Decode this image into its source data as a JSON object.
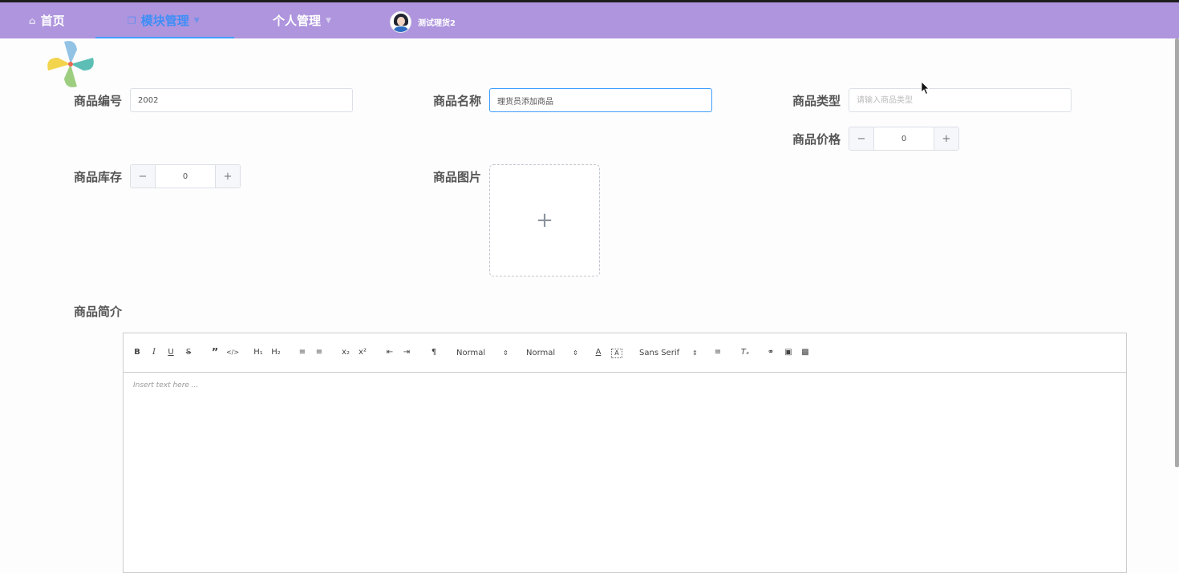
{
  "nav": {
    "home": "首页",
    "modules": "模块管理",
    "personal": "个人管理",
    "user_name": "测试理货2"
  },
  "form": {
    "code_label": "商品编号",
    "code_value": "2002",
    "name_label": "商品名称",
    "name_value": "理货员添加商品",
    "type_label": "商品类型",
    "type_placeholder": "请输入商品类型",
    "price_label": "商品价格",
    "price_value": "0",
    "stock_label": "商品库存",
    "stock_value": "0",
    "image_label": "商品图片",
    "desc_label": "商品简介"
  },
  "editor": {
    "tb_header1": "H₁",
    "tb_header2": "H₂",
    "tb_sub": "x₂",
    "tb_sup": "x²",
    "size_label": "Normal",
    "header_label": "Normal",
    "font_label": "Sans Serif",
    "placeholder": "Insert text here ..."
  },
  "colors": {
    "topbar": "#ae95dd",
    "active": "#409eff"
  }
}
